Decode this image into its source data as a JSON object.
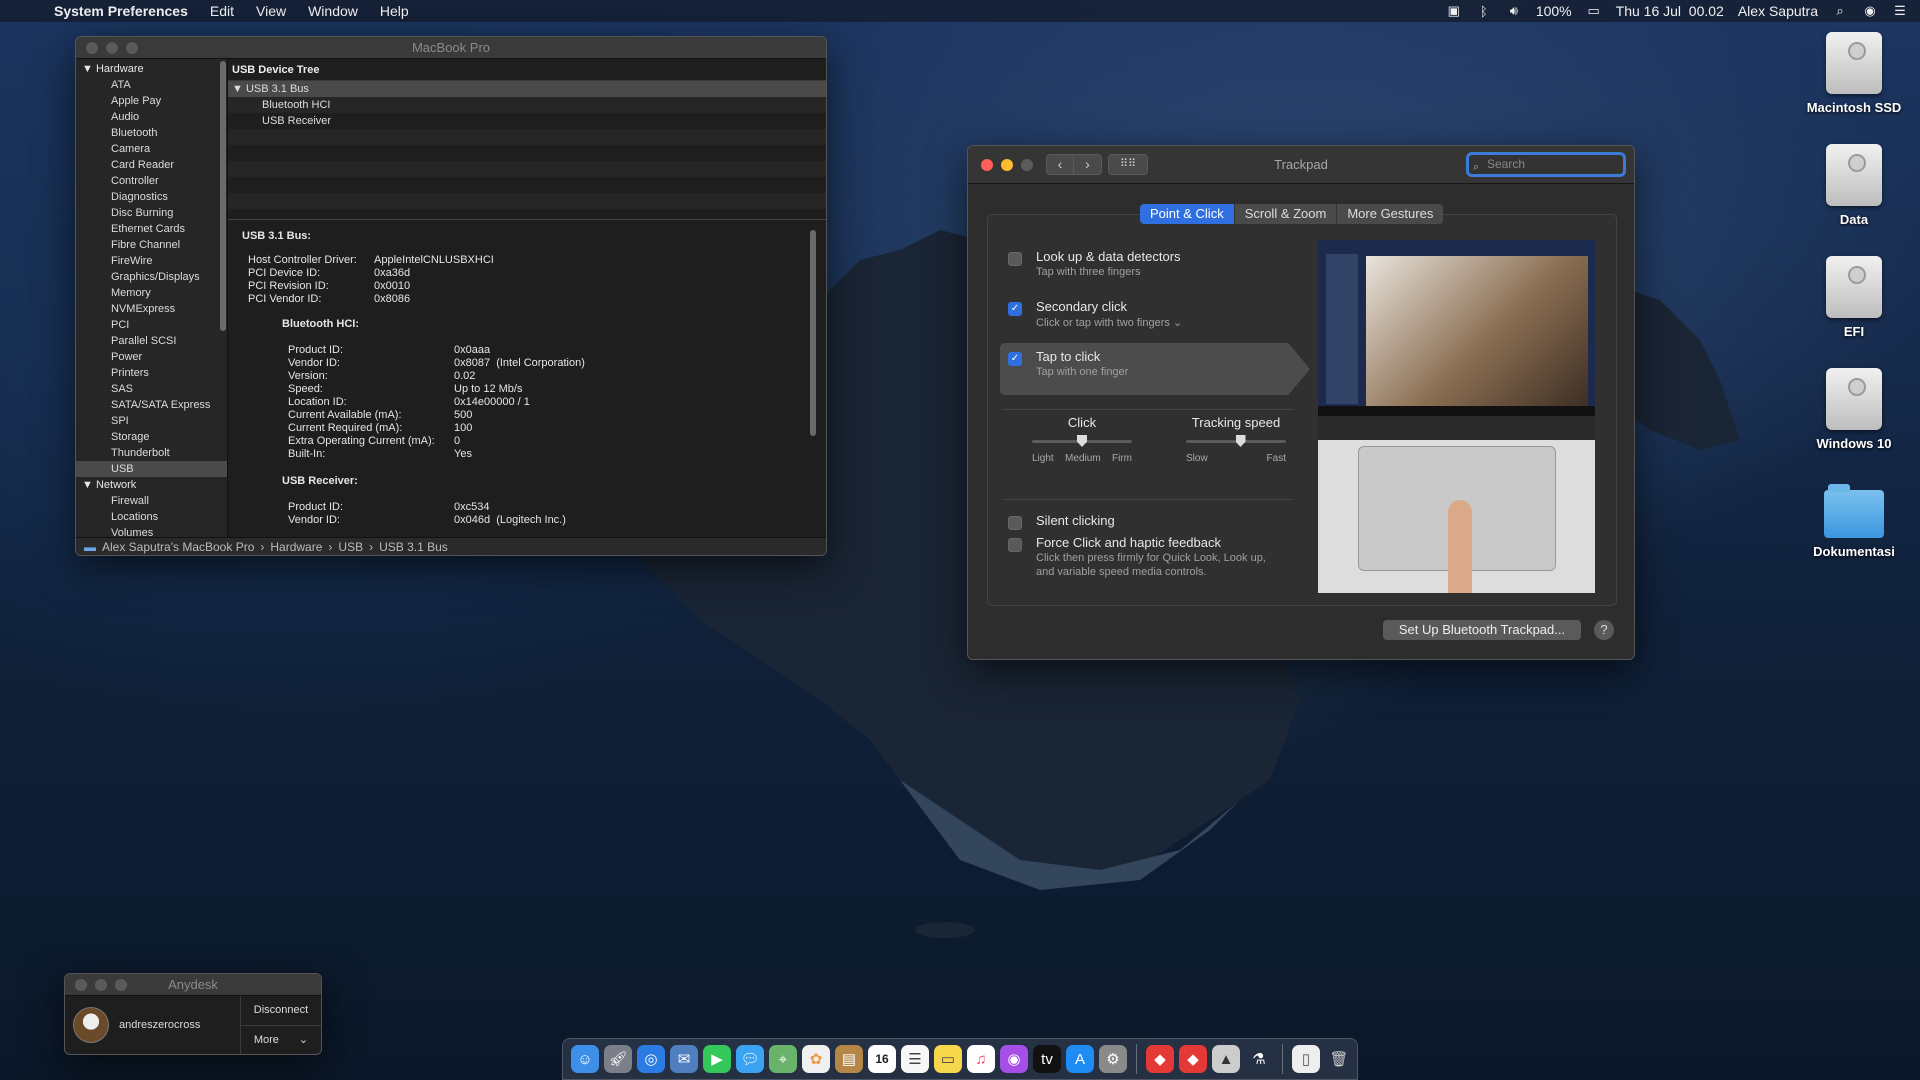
{
  "menubar": {
    "app_name": "System Preferences",
    "menus": [
      "Edit",
      "View",
      "Window",
      "Help"
    ],
    "battery": "100%",
    "datetime": "Thu 16 Jul  00.02",
    "user": "Alex Saputra"
  },
  "sysinfo": {
    "title": "MacBook Pro",
    "sidebar": {
      "hardware_label": "Hardware",
      "hardware_items": [
        "ATA",
        "Apple Pay",
        "Audio",
        "Bluetooth",
        "Camera",
        "Card Reader",
        "Controller",
        "Diagnostics",
        "Disc Burning",
        "Ethernet Cards",
        "Fibre Channel",
        "FireWire",
        "Graphics/Displays",
        "Memory",
        "NVMExpress",
        "PCI",
        "Parallel SCSI",
        "Power",
        "Printers",
        "SAS",
        "SATA/SATA Express",
        "SPI",
        "Storage",
        "Thunderbolt",
        "USB"
      ],
      "network_label": "Network",
      "network_items": [
        "Firewall",
        "Locations",
        "Volumes"
      ]
    },
    "tree": {
      "header": "USB Device Tree",
      "root": "USB 3.1 Bus",
      "children": [
        "Bluetooth HCI",
        "USB Receiver"
      ]
    },
    "detail": {
      "heading": "USB 3.1 Bus:",
      "bus_rows": [
        {
          "k": "Host Controller Driver:",
          "v": "AppleIntelCNLUSBXHCI"
        },
        {
          "k": "PCI Device ID:",
          "v": "0xa36d"
        },
        {
          "k": "PCI Revision ID:",
          "v": "0x0010"
        },
        {
          "k": "PCI Vendor ID:",
          "v": "0x8086"
        }
      ],
      "bt_heading": "Bluetooth HCI:",
      "bt_rows": [
        {
          "k": "Product ID:",
          "v": "0x0aaa"
        },
        {
          "k": "Vendor ID:",
          "v": "0x8087  (Intel Corporation)"
        },
        {
          "k": "Version:",
          "v": "0.02"
        },
        {
          "k": "Speed:",
          "v": "Up to 12 Mb/s"
        },
        {
          "k": "Location ID:",
          "v": "0x14e00000 / 1"
        },
        {
          "k": "Current Available (mA):",
          "v": "500"
        },
        {
          "k": "Current Required (mA):",
          "v": "100"
        },
        {
          "k": "Extra Operating Current (mA):",
          "v": "0"
        },
        {
          "k": "Built-In:",
          "v": "Yes"
        }
      ],
      "rx_heading": "USB Receiver:",
      "rx_rows": [
        {
          "k": "Product ID:",
          "v": "0xc534"
        },
        {
          "k": "Vendor ID:",
          "v": "0x046d  (Logitech Inc.)"
        }
      ]
    },
    "path": [
      "Alex Saputra's MacBook Pro",
      "Hardware",
      "USB",
      "USB 3.1 Bus"
    ]
  },
  "trackpad": {
    "title": "Trackpad",
    "search_placeholder": "Search",
    "tabs": [
      "Point & Click",
      "Scroll & Zoom",
      "More Gestures"
    ],
    "options": {
      "lookup": {
        "label": "Look up & data detectors",
        "sub": "Tap with three fingers",
        "checked": false
      },
      "secondary": {
        "label": "Secondary click",
        "sub": "Click or tap with two fingers ⌄",
        "checked": true
      },
      "tap": {
        "label": "Tap to click",
        "sub": "Tap with one finger",
        "checked": true
      }
    },
    "click_slider": {
      "title": "Click",
      "ticks": [
        "Light",
        "Medium",
        "Firm"
      ],
      "value": "Medium"
    },
    "speed_slider": {
      "title": "Tracking speed",
      "ticks": [
        "Slow",
        "Fast"
      ],
      "level": 0.55
    },
    "silent": {
      "label": "Silent clicking",
      "checked": false
    },
    "force": {
      "label": "Force Click and haptic feedback",
      "sub1": "Click then press firmly for Quick Look, Look up,",
      "sub2": "and variable speed media controls.",
      "checked": false
    },
    "setup_button": "Set Up Bluetooth Trackpad...",
    "help": "?"
  },
  "desktop_icons": [
    {
      "label": "Macintosh SSD",
      "icon": "drive-icon"
    },
    {
      "label": "Data",
      "icon": "drive-icon"
    },
    {
      "label": "EFI",
      "icon": "drive-icon"
    },
    {
      "label": "Windows 10",
      "icon": "drive-icon"
    },
    {
      "label": "Dokumentasi",
      "icon": "folder-icon"
    }
  ],
  "anydesk": {
    "title": "Anydesk",
    "user": "andreszerocross",
    "disconnect": "Disconnect",
    "more": "More"
  },
  "dock": {
    "calendar_day": "16"
  }
}
